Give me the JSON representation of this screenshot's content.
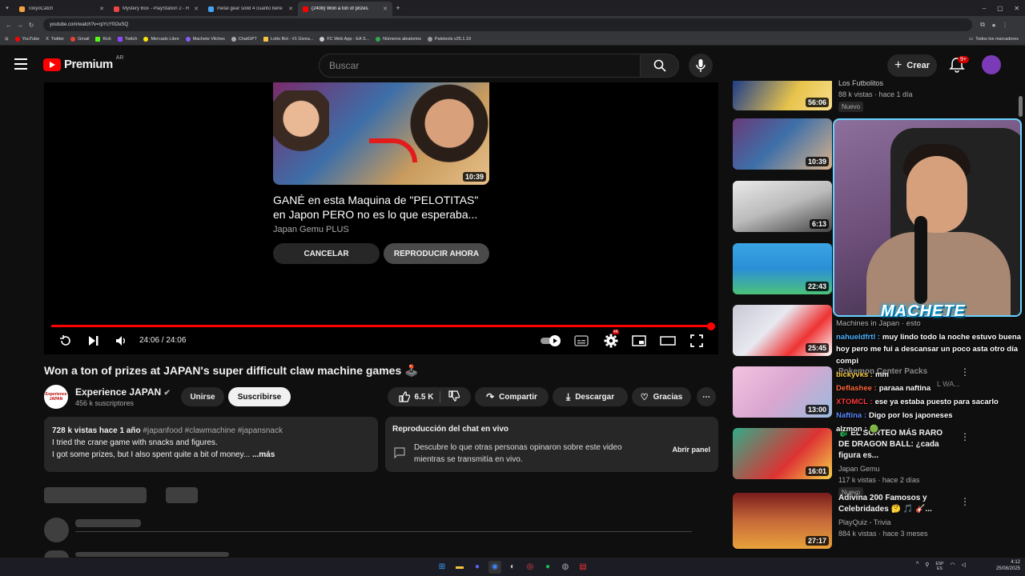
{
  "browser": {
    "tabs": [
      {
        "title": "TokyoCatch",
        "active": false,
        "favicon_color": "#f4a23b"
      },
      {
        "title": "Mystery Box - PlayStation 2 - R",
        "active": false,
        "favicon_color": "#e44"
      },
      {
        "title": "metal gear solid 4 cuanto tiene",
        "active": false,
        "favicon_color": "#4aa3f0"
      },
      {
        "title": "(2408) Won a ton of prizes",
        "active": true,
        "favicon_color": "#ff0000"
      }
    ],
    "url": "youtube.com/watch?v=rpYcY0I2eSQ",
    "bookmarks": [
      "YouTube",
      "Twitter",
      "Gmail",
      "Kick",
      "Twitch",
      "Mercado Libre",
      "Machete Vilches",
      "ChatGPT",
      "Lotto Bot - #1 Givea...",
      "FC Web App - EA S...",
      "Números aleatorios",
      "Paletools v25.1.19"
    ],
    "all_bookmarks": "Todos los marcadores"
  },
  "header": {
    "logo_text": "Premium",
    "country": "AR",
    "search_placeholder": "Buscar",
    "create_label": "Crear",
    "notifications_badge": "9+"
  },
  "player": {
    "endscreen": {
      "duration": "10:39",
      "title": "GANÉ en esta Maquina de \"PELOTITAS\" en Japon PERO no es lo que esperaba...",
      "channel": "Japan Gemu PLUS",
      "cancel_label": "CANCELAR",
      "play_now_label": "REPRODUCIR AHORA"
    },
    "time": "24:06 / 24:06",
    "progress_fraction": 1.0,
    "quality_badge": "4K"
  },
  "video": {
    "title": "Won a ton of prizes at JAPAN's super difficult claw machine games 🕹️",
    "channel_name": "Experience JAPAN",
    "channel_avatar_text": "Experience JAPAN",
    "subscribers": "456 k suscriptores",
    "join_label": "Unirse",
    "subscribe_label": "Suscribirse",
    "likes": "6.5 K",
    "share_label": "Compartir",
    "download_label": "Descargar",
    "thanks_label": "Gracias",
    "description": {
      "stats": "728 k vistas  hace 1 año",
      "hashtags": "#japanfood #clawmachine #japansnack",
      "line1": "I tried the crane game with snacks and figures.",
      "line2": "I got some prizes, but I also spent quite a bit of money...",
      "more": "...más"
    },
    "chat_replay": {
      "title": "Reproducción del chat en vivo",
      "description": "Descubre lo que otras personas opinaron sobre este video mientras se transmitía en vivo.",
      "open_label": "Abrir panel"
    }
  },
  "sidebar": {
    "items": [
      {
        "duration": "56:06",
        "title": "",
        "channel": "Los Futbolitos",
        "meta": "88 k vistas · hace 1 día",
        "badge": "Nuevo",
        "colors": [
          "#1f3d8a",
          "#e8c44c"
        ]
      },
      {
        "duration": "10:39",
        "title": "",
        "channel": "",
        "meta": "",
        "badge": "",
        "colors": [
          "#6a3b7a",
          "#d9b28a"
        ]
      },
      {
        "duration": "6:13",
        "title": "",
        "channel": "",
        "meta": "",
        "badge": "",
        "colors": [
          "#ddd",
          "#555"
        ]
      },
      {
        "duration": "22:43",
        "title": "",
        "channel": "",
        "meta": "",
        "badge": "",
        "colors": [
          "#2b8fd6",
          "#4cc27a"
        ]
      },
      {
        "duration": "25:45",
        "title": "",
        "channel": "",
        "meta": "",
        "badge": "",
        "colors": [
          "#c9c9d6",
          "#e33"
        ]
      },
      {
        "duration": "13:00",
        "title": "",
        "channel": "",
        "meta": "",
        "badge": "",
        "colors": [
          "#f3c3e0",
          "#9bd"
        ]
      },
      {
        "duration": "16:01",
        "title": "🐉 EL SORTEO MÁS RARO DE DRAGON BALL: ¿cada figura es...",
        "channel": "Japan Gemu",
        "meta": "117 k vistas · hace 2 días",
        "badge": "Nuevo",
        "colors": [
          "#d33",
          "#3a8"
        ]
      },
      {
        "duration": "27:17",
        "title": "Adivina 200 Famosos y Celebridades 🤔 🎵 🎸...",
        "channel": "PlayQuiz - Trivia",
        "meta": "884 k vistas · hace 3 meses",
        "badge": "",
        "colors": [
          "#7a1c1c",
          "#e8a23a"
        ]
      }
    ]
  },
  "stream_overlay": {
    "name": "MACHETE",
    "chat": [
      {
        "user": "",
        "text": "Machines in Japan  · esto",
        "color": "#bbb"
      },
      {
        "user": "nahueldfrtl :",
        "text": "muy lindo todo la noche estuvo buena hoy pero me fui a descansar un poco asta otro día compi",
        "color": "#4fb3ff"
      },
      {
        "user": "bickyvks :",
        "text": "mm",
        "color": "#ffd24a"
      },
      {
        "user": "Deflashee :",
        "text": "paraaa naftina",
        "color": "#ff6a3d"
      },
      {
        "user": "XTOMCL :",
        "text": "ese ya estaba puesto para sacarlo",
        "color": "#ff3b3b"
      },
      {
        "user": "Naftina :",
        "text": "Digo por los japoneses",
        "color": "#5b8cff"
      },
      {
        "user": "alzmon :",
        "text": "🟢",
        "color": "#fff"
      }
    ],
    "pokemon_title": "Pokemon Center Packs",
    "pokemon_meta": "L WA..."
  },
  "taskbar": {
    "lang": "ESP",
    "lang2": "ES",
    "time": "4:12",
    "date": "25/08/2025"
  }
}
